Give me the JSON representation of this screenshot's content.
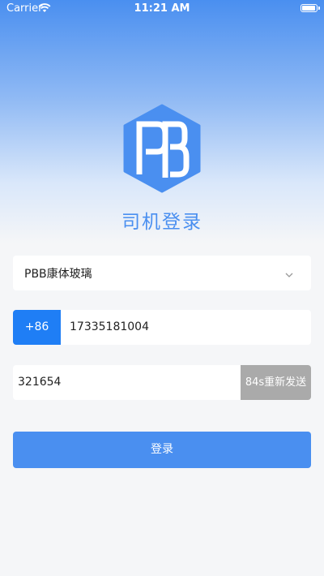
{
  "status_bar": {
    "carrier": "Carrier",
    "time": "11:21 AM",
    "wifi_icon": "wifi-icon",
    "battery_icon": "battery-icon"
  },
  "logo": {
    "text": "PB",
    "color": "#4a8ff0"
  },
  "title": "司机登录",
  "company": {
    "selected": "PBB康体玻璃",
    "icon": "chevron-down-icon"
  },
  "phone": {
    "country_code": "+86",
    "number": "17335181004"
  },
  "code": {
    "value": "321654",
    "resend_label": "84s重新发送"
  },
  "login_label": "登录",
  "colors": {
    "primary": "#4a8ff0",
    "country_code_bg": "#1f7ef5",
    "resend_bg": "#aaaaaa"
  }
}
